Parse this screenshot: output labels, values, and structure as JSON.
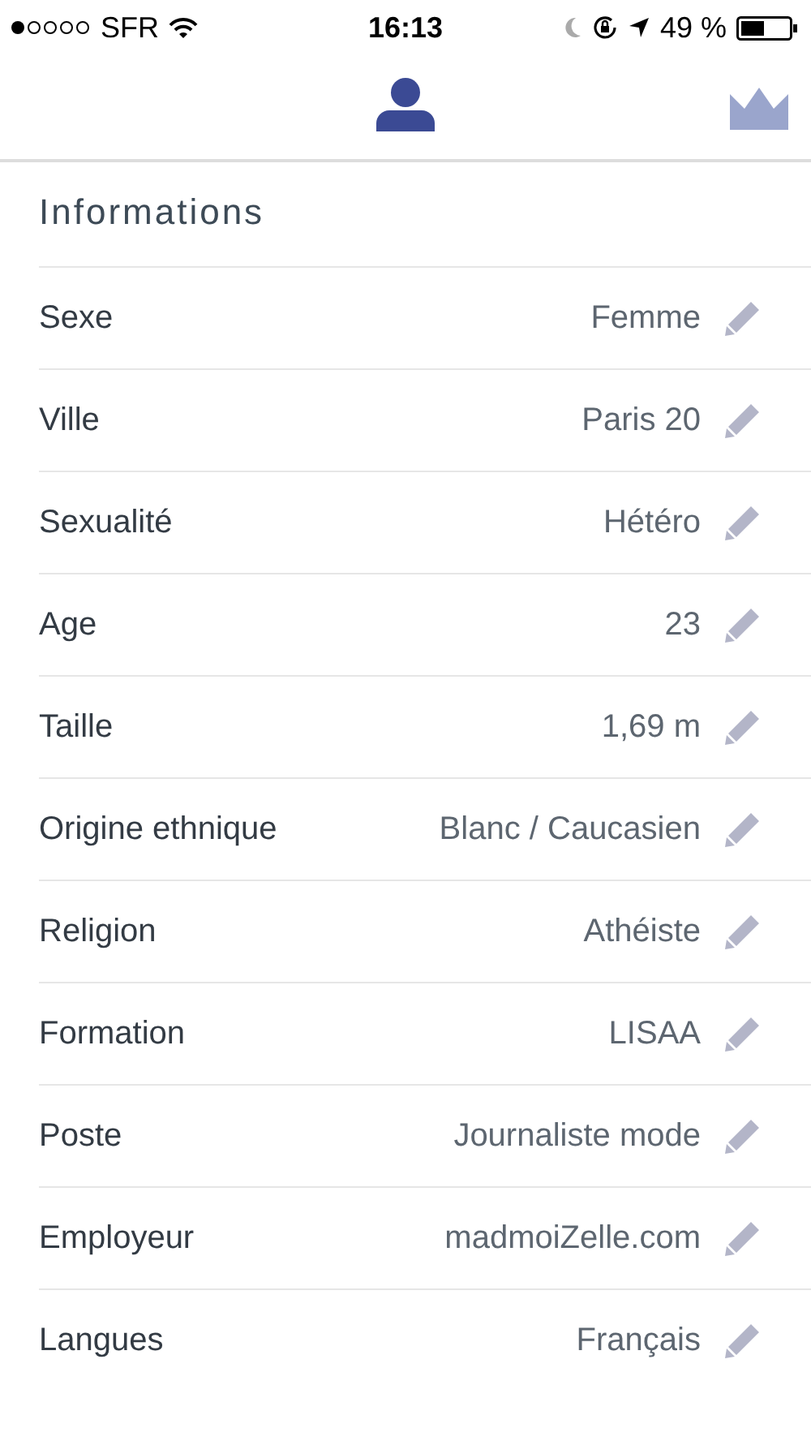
{
  "status_bar": {
    "carrier": "SFR",
    "time": "16:13",
    "battery_text": "49 %"
  },
  "tabs": [
    {
      "kind": "profile",
      "selected": true
    },
    {
      "kind": "premium",
      "selected": false
    }
  ],
  "section_title": "Informations",
  "fields": [
    {
      "label": "Sexe",
      "value": "Femme"
    },
    {
      "label": "Ville",
      "value": "Paris 20"
    },
    {
      "label": "Sexualité",
      "value": "Hétéro"
    },
    {
      "label": "Age",
      "value": "23"
    },
    {
      "label": "Taille",
      "value": "1,69 m"
    },
    {
      "label": "Origine ethnique",
      "value": "Blanc / Caucasien"
    },
    {
      "label": "Religion",
      "value": "Athéiste"
    },
    {
      "label": "Formation",
      "value": "LISAA"
    },
    {
      "label": "Poste",
      "value": "Journaliste mode"
    },
    {
      "label": "Employeur",
      "value": "madmoiZelle.com"
    },
    {
      "label": "Langues",
      "value": "Français"
    }
  ]
}
